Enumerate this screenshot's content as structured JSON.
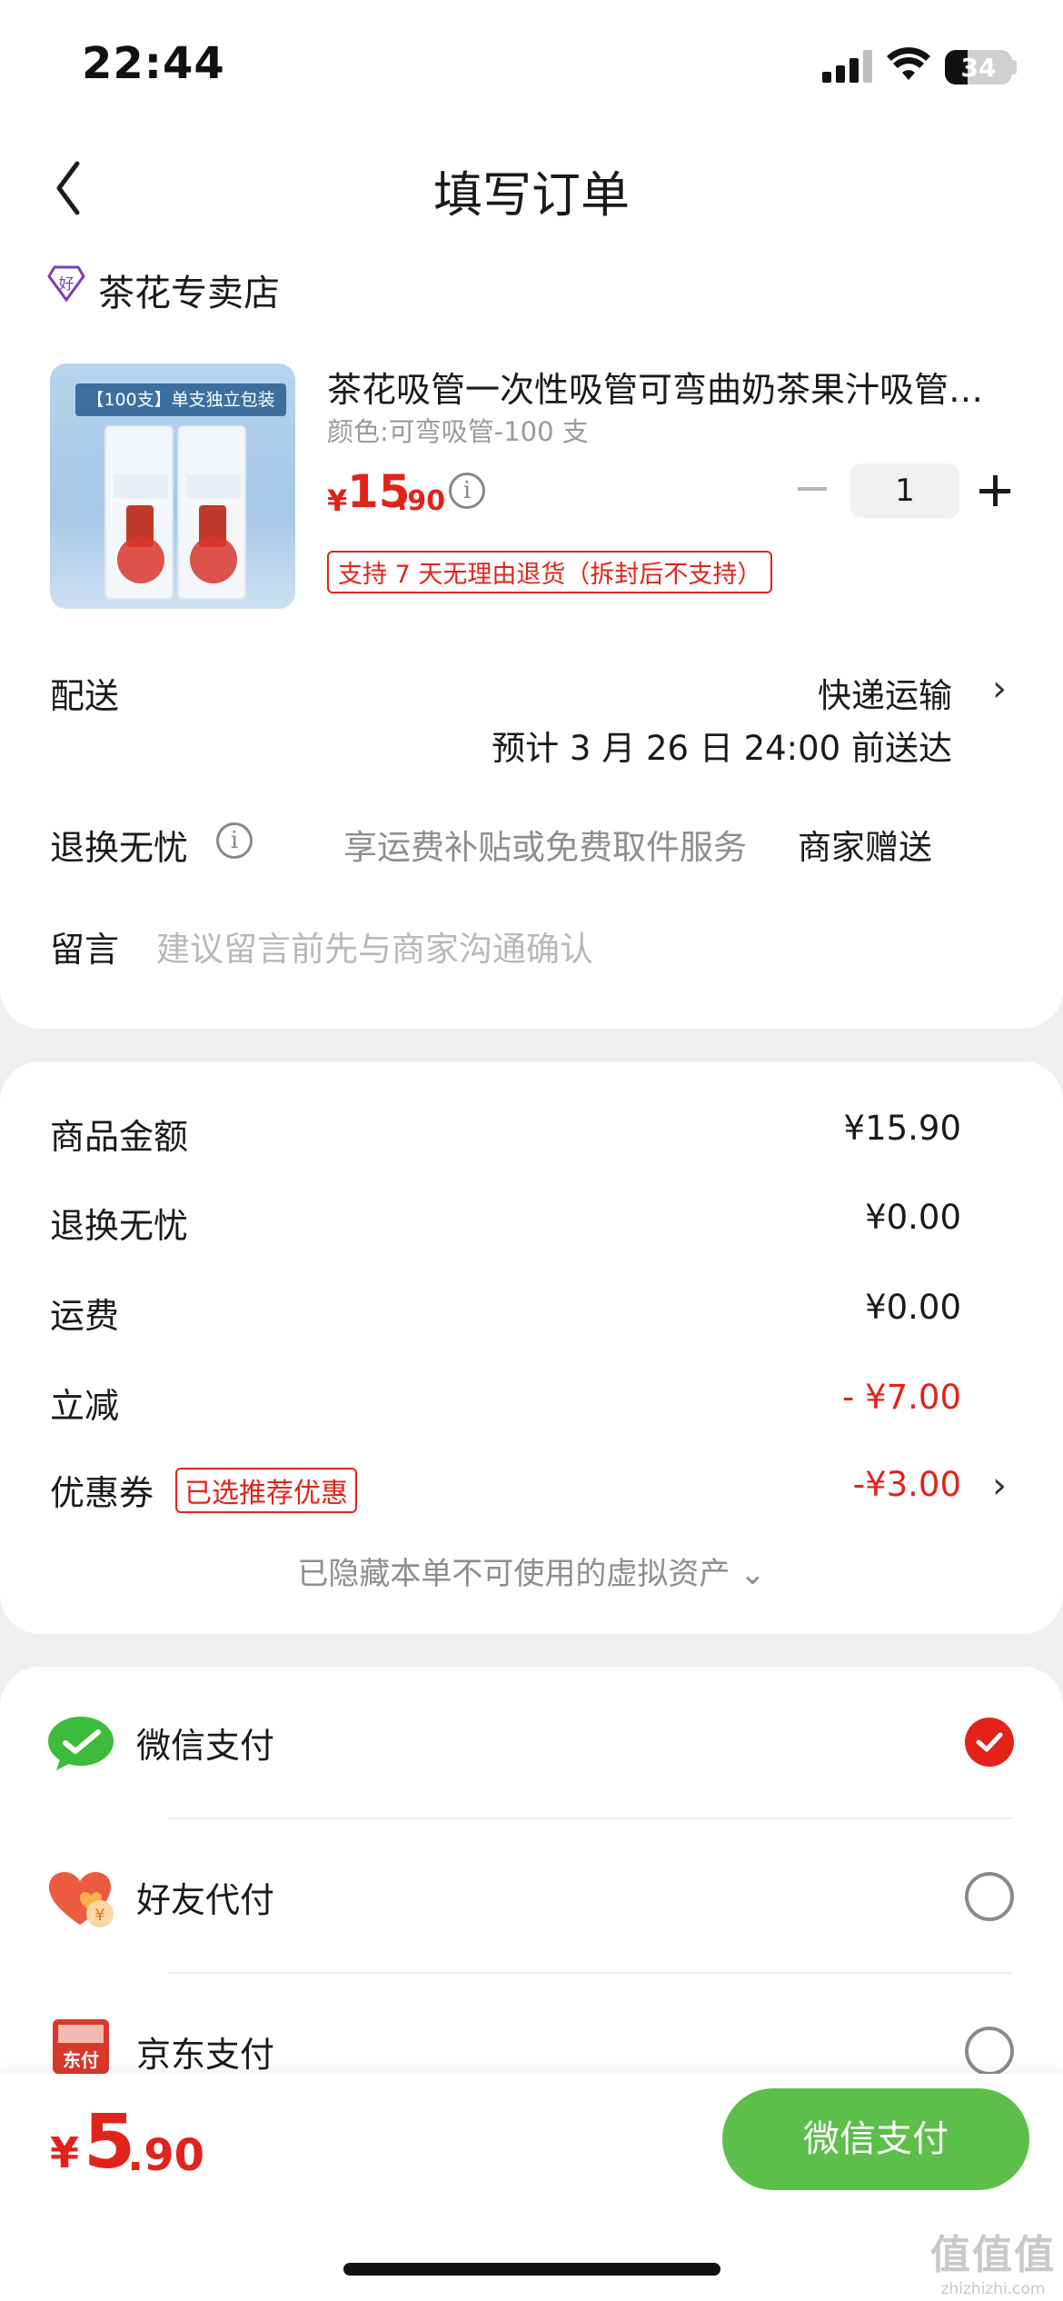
{
  "status_bar": {
    "time": "22:44",
    "battery": "34"
  },
  "header": {
    "title": "填写订单"
  },
  "shop": {
    "name": "茶花专卖店"
  },
  "product": {
    "image_banner": "【100支】单支独立包装",
    "title": "茶花吸管一次性吸管可弯曲奶茶果汁吸管独立包装",
    "spec": "颜色:可弯吸管-100 支",
    "price_symbol": "¥",
    "price_int": "15",
    "price_dec": ".90",
    "quantity": "1",
    "return_policy": "支持 7 天无理由退货（拆封后不支持）"
  },
  "delivery": {
    "label": "配送",
    "method": "快递运输",
    "eta": "预计 3 月 26 日 24:00 前送达"
  },
  "worry_free": {
    "label": "退换无忧",
    "service": "享运费补贴或免费取件服务",
    "value": "商家赠送"
  },
  "message": {
    "label": "留言",
    "placeholder": "建议留言前先与商家沟通确认"
  },
  "summary": {
    "items": [
      {
        "label": "商品金额",
        "value": "¥15.90"
      },
      {
        "label": "退换无忧",
        "value": "¥0.00"
      },
      {
        "label": "运费",
        "value": "¥0.00"
      },
      {
        "label": "立减",
        "value": "- ¥7.00"
      },
      {
        "label": "优惠券",
        "value": "-¥3.00"
      }
    ],
    "coupon_badge": "已选推荐优惠",
    "hidden_assets": "已隐藏本单不可使用的虚拟资产 ⌄"
  },
  "payment": {
    "methods": [
      {
        "label": "微信支付",
        "selected": true
      },
      {
        "label": "好友代付",
        "selected": false
      },
      {
        "label": "京东支付",
        "selected": false
      }
    ],
    "jd_icon_text": "东付"
  },
  "footer": {
    "total_symbol": "¥",
    "total_int": "5",
    "total_dec": ".90",
    "pay_button": "微信支付"
  },
  "watermark": {
    "big": "值值值",
    "small": "zhizhizhi.com"
  },
  "colors": {
    "accent_red": "#e2231a",
    "wechat_green": "#5bbf49"
  }
}
